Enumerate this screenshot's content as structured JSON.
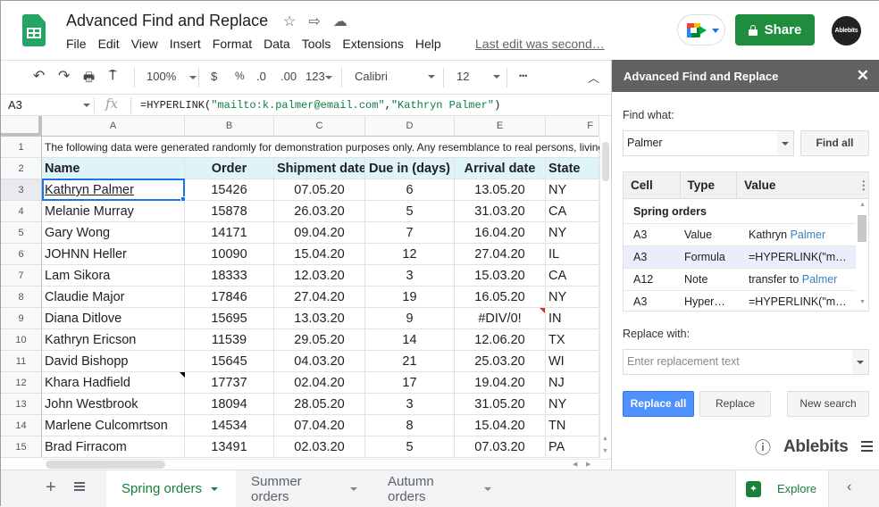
{
  "app": {
    "doc_title": "Advanced Find and Replace",
    "menu": [
      "File",
      "Edit",
      "View",
      "Insert",
      "Format",
      "Data",
      "Tools",
      "Extensions",
      "Help"
    ],
    "last_edit": "Last edit was second…",
    "share_label": "Share",
    "avatar_label": "Ablebits"
  },
  "toolbar": {
    "zoom": "100%",
    "currency": "$",
    "percent": "%",
    "dec_decrease": ".0",
    "dec_increase": ".00",
    "number_format": "123",
    "font": "Calibri",
    "font_size": "12",
    "more": "•••"
  },
  "formula_bar": {
    "cell_ref": "A3",
    "fx": "fx",
    "formula_prefix": "=HYPERLINK(",
    "formula_arg1": "\"mailto:k.palmer@email.com\"",
    "formula_comma": ",",
    "formula_arg2": "\"Kathryn Palmer\"",
    "formula_suffix": ")"
  },
  "sheet": {
    "columns": [
      "A",
      "B",
      "C",
      "D",
      "E",
      "F"
    ],
    "row1_note": "The following data were generated randomly for demonstration purposes only. Any resemblance to real persons, living or dead",
    "headers": [
      "Name",
      "Order",
      "Shipment date",
      "Due in (days)",
      "Arrival date",
      "State"
    ],
    "rows": [
      {
        "n": "3",
        "cells": [
          "Kathryn Palmer",
          "15426",
          "07.05.20",
          "6",
          "13.05.20",
          "NY"
        ]
      },
      {
        "n": "4",
        "cells": [
          "Melanie Murray",
          "15878",
          "26.03.20",
          "5",
          "31.03.20",
          "CA"
        ]
      },
      {
        "n": "5",
        "cells": [
          "Gary Wong",
          "14171",
          "09.04.20",
          "7",
          "16.04.20",
          "NY"
        ]
      },
      {
        "n": "6",
        "cells": [
          "JOHNN Heller",
          "10090",
          "15.04.20",
          "12",
          "27.04.20",
          "IL"
        ]
      },
      {
        "n": "7",
        "cells": [
          "Lam Sikora",
          "18333",
          "12.03.20",
          "3",
          "15.03.20",
          "CA"
        ]
      },
      {
        "n": "8",
        "cells": [
          "Claudie Major",
          "17846",
          "27.04.20",
          "19",
          "16.05.20",
          "NY"
        ]
      },
      {
        "n": "9",
        "cells": [
          "Diana Ditlove",
          "15695",
          "13.03.20",
          "9",
          "#DIV/0!",
          "IN"
        ]
      },
      {
        "n": "10",
        "cells": [
          "Kathryn Ericson",
          "11539",
          "29.05.20",
          "14",
          "12.06.20",
          "TX"
        ]
      },
      {
        "n": "11",
        "cells": [
          "David Bishopp",
          "15645",
          "04.03.20",
          "21",
          "25.03.20",
          "WI"
        ]
      },
      {
        "n": "12",
        "cells": [
          "Khara Hadfield",
          "17737",
          "02.04.20",
          "17",
          "19.04.20",
          "NJ"
        ]
      },
      {
        "n": "13",
        "cells": [
          "John Westbrook",
          "18094",
          "28.05.20",
          "3",
          "31.05.20",
          "NY"
        ]
      },
      {
        "n": "14",
        "cells": [
          "Marlene Culcomrtson",
          "14534",
          "07.04.20",
          "8",
          "15.04.20",
          "TN"
        ]
      },
      {
        "n": "15",
        "cells": [
          "Brad Firracom",
          "13491",
          "02.03.20",
          "5",
          "07.03.20",
          "PA"
        ]
      }
    ]
  },
  "sheet_tabs": [
    {
      "label": "Spring orders",
      "active": true
    },
    {
      "label": "Summer orders",
      "active": false
    },
    {
      "label": "Autumn orders",
      "active": false
    }
  ],
  "explore_label": "Explore",
  "panel": {
    "title": "Advanced Find and Replace",
    "find_label": "Find what:",
    "find_value": "Palmer",
    "find_all": "Find all",
    "results_headers": [
      "Cell",
      "Type",
      "Value"
    ],
    "results_group": "Spring orders",
    "results": [
      {
        "cell": "A3",
        "type": "Value",
        "pre": "Kathryn ",
        "match": "Palmer",
        "post": "",
        "selected": false
      },
      {
        "cell": "A3",
        "type": "Formula",
        "pre": "=HYPERLINK(\"m…",
        "match": "",
        "post": "",
        "selected": true
      },
      {
        "cell": "A12",
        "type": "Note",
        "pre": "transfer to ",
        "match": "Palmer",
        "post": "",
        "selected": false
      },
      {
        "cell": "A3",
        "type": "Hyper…",
        "pre": "=HYPERLINK(\"m…",
        "match": "",
        "post": "",
        "selected": false
      }
    ],
    "replace_label": "Replace with:",
    "replace_placeholder": "Enter replacement text",
    "replace_all": "Replace all",
    "replace": "Replace",
    "new_search": "New search",
    "brand": "Ablebits"
  },
  "colors": {
    "share_green": "#1e8e3e",
    "active_tab_green": "#188038",
    "header_fill": "#def4f7",
    "selection_blue": "#1a73e8",
    "panel_header": "#616161",
    "primary_button": "#4d90fe",
    "match_highlight": "#3b7fc4"
  }
}
